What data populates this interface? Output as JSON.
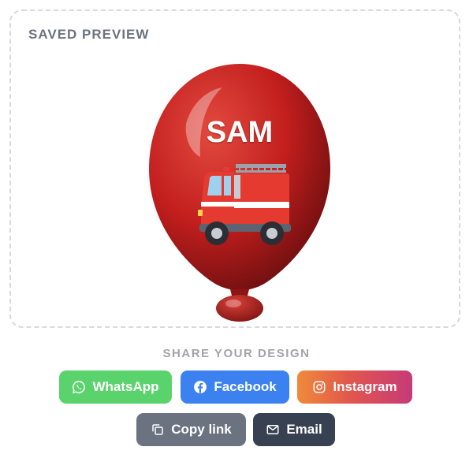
{
  "preview": {
    "title": "SAVED PREVIEW",
    "balloon_name": "SAM",
    "balloon_color": "#c8201f",
    "emoji": "fire-engine"
  },
  "share": {
    "title": "SHARE YOUR DESIGN",
    "buttons": {
      "whatsapp": "WhatsApp",
      "facebook": "Facebook",
      "instagram": "Instagram",
      "copy_link": "Copy link",
      "email": "Email"
    }
  },
  "colors": {
    "whatsapp": "#5bd36d",
    "facebook": "#3b82f0",
    "instagram_start": "#ef8a3a",
    "instagram_end": "#c63a78",
    "copy_link": "#6b7280",
    "email": "#374151"
  }
}
